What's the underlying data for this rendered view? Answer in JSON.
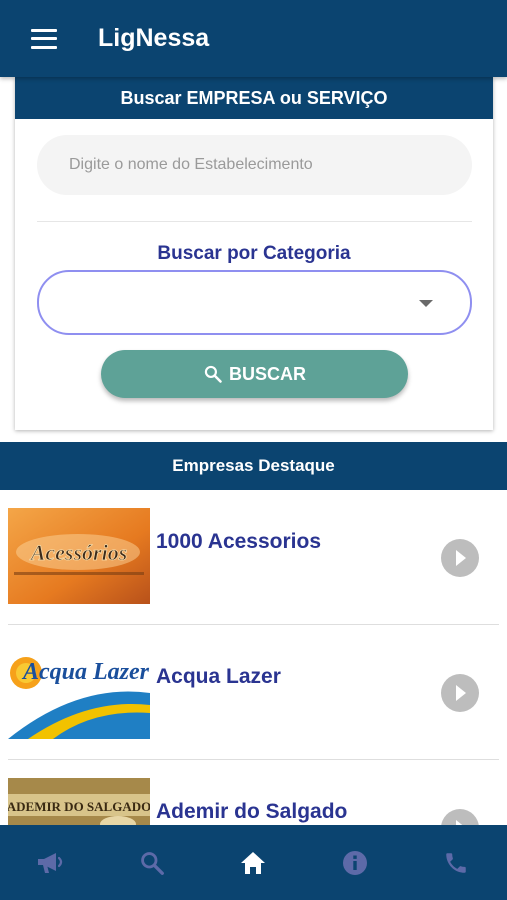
{
  "appbar": {
    "title": "LigNessa",
    "menu_icon": "hamburger-menu-icon"
  },
  "search": {
    "header": "Buscar EMPRESA ou SERVIÇO",
    "placeholder": "Digite o nome do Estabelecimento",
    "category_label": "Buscar por Categoria",
    "category_value": "",
    "button_label": "BUSCAR",
    "button_icon": "search-icon"
  },
  "featured": {
    "header": "Empresas Destaque",
    "companies": [
      {
        "name": "1000 Acessorios",
        "logo_text": "Acessórios"
      },
      {
        "name": "Acqua Lazer",
        "logo_text": "Acqua Lazer"
      },
      {
        "name": "Ademir do Salgado",
        "logo_text": "ADEMIR DO SALGADO"
      }
    ]
  },
  "bottom_nav": {
    "items": [
      {
        "icon": "megaphone-icon",
        "active": false
      },
      {
        "icon": "search-icon",
        "active": false
      },
      {
        "icon": "home-icon",
        "active": true
      },
      {
        "icon": "info-icon",
        "active": false
      },
      {
        "icon": "phone-icon",
        "active": false
      }
    ]
  },
  "colors": {
    "primary": "#0b4470",
    "accent_text": "#2a3491",
    "button": "#5ea297",
    "select_border": "#8f8ff0",
    "nav_inactive_icon": "#5d6aa8"
  }
}
